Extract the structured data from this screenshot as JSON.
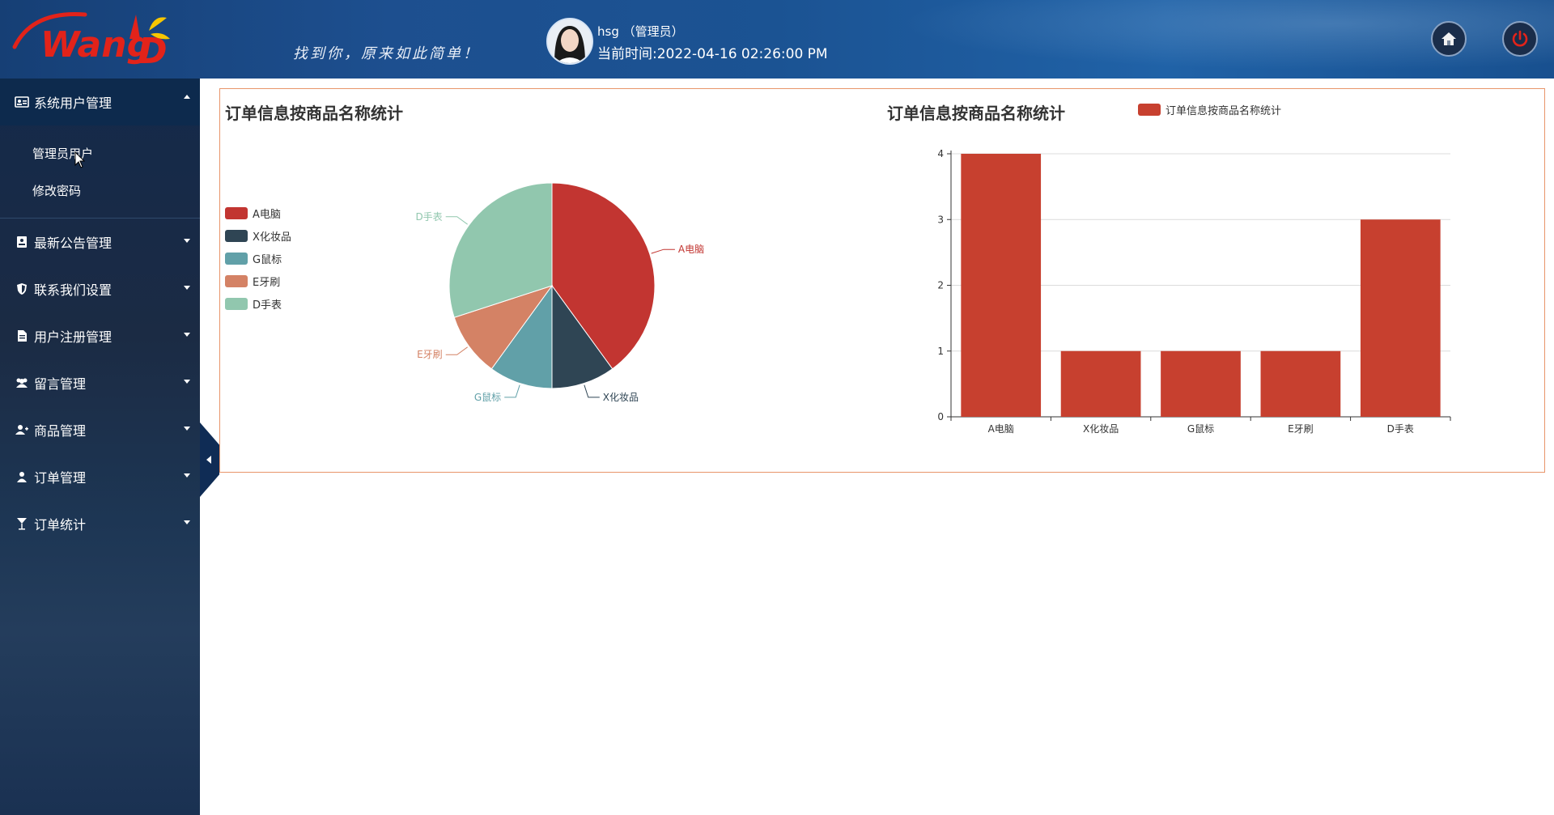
{
  "header": {
    "logo_text": "Wang D",
    "slogan": "找到你，原来如此简单！",
    "user_name": "hsg （管理员）",
    "current_time": "当前时间:2022-04-16 02:26:00 PM",
    "home_icon": "home-icon",
    "power_icon": "power-icon"
  },
  "sidebar": {
    "items": [
      {
        "label": "系统用户管理",
        "icon": "user-card-icon",
        "expanded": true
      },
      {
        "label": "最新公告管理",
        "icon": "notice-icon",
        "expanded": false
      },
      {
        "label": "联系我们设置",
        "icon": "shield-icon",
        "expanded": false
      },
      {
        "label": "用户注册管理",
        "icon": "document-icon",
        "expanded": false
      },
      {
        "label": "留言管理",
        "icon": "users-icon",
        "expanded": false
      },
      {
        "label": "商品管理",
        "icon": "user-plus-icon",
        "expanded": false
      },
      {
        "label": "订单管理",
        "icon": "user-icon",
        "expanded": false
      },
      {
        "label": "订单统计",
        "icon": "cocktail-icon",
        "expanded": false
      }
    ],
    "submenu": [
      "管理员用户",
      "修改密码"
    ]
  },
  "colors": {
    "header_bg": "#1d4f8f",
    "sidebar_bg": "#1b2b44",
    "panel_border": "#e8956a",
    "series": [
      "#c23531",
      "#2f4554",
      "#61a0a8",
      "#d48265",
      "#91c7ae"
    ],
    "bar": "#c7402f"
  },
  "chart_data": [
    {
      "type": "pie",
      "title": "订单信息按商品名称统计",
      "categories": [
        "A电脑",
        "X化妆品",
        "G鼠标",
        "E牙刷",
        "D手表"
      ],
      "values": [
        4,
        1,
        1,
        1,
        3
      ],
      "legend_position": "left"
    },
    {
      "type": "bar",
      "title": "订单信息按商品名称统计",
      "categories": [
        "A电脑",
        "X化妆品",
        "G鼠标",
        "E牙刷",
        "D手表"
      ],
      "series": [
        {
          "name": "订单信息按商品名称统计",
          "values": [
            4,
            1,
            1,
            1,
            3
          ]
        }
      ],
      "ylim": [
        0,
        4
      ],
      "yticks": [
        0,
        1,
        2,
        3,
        4
      ],
      "grid": true,
      "legend_position": "top"
    }
  ]
}
